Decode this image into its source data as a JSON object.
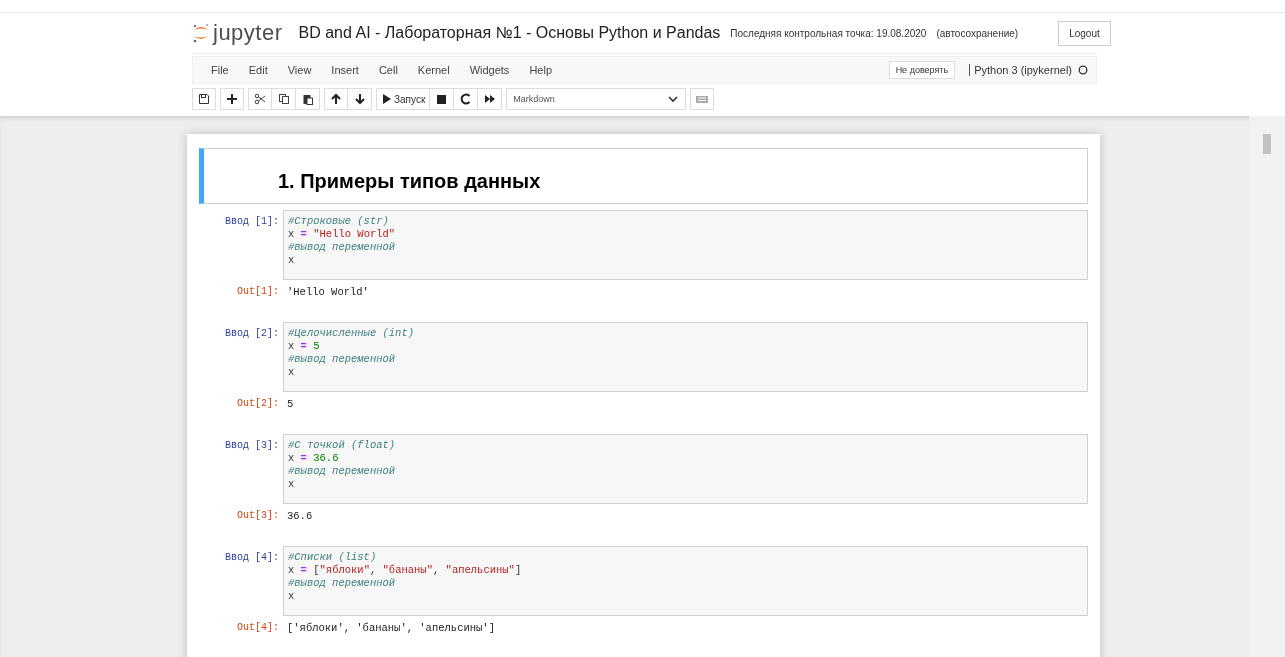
{
  "header": {
    "logo_text": "jupyter",
    "title": "BD and AI - Лабораторная №1 - Основы Python и Pandas",
    "checkpoint": "Последняя контрольная точка: 19.08.2020",
    "autosave": "(автосохранение)",
    "logout": "Logout"
  },
  "menu": {
    "items": [
      "File",
      "Edit",
      "View",
      "Insert",
      "Cell",
      "Kernel",
      "Widgets",
      "Help"
    ],
    "trust": "Не доверять",
    "kernel": {
      "name": "Python 3 (ipykernel)",
      "busy": false
    }
  },
  "toolbar": {
    "run_label": "Запуск",
    "cell_type": "Markdown"
  },
  "cells": [
    {
      "kind": "markdown",
      "selected": true,
      "heading": "1. Примеры типов данных"
    },
    {
      "kind": "code",
      "selected": false,
      "prompt": "Ввод [1]:",
      "lines": [
        [
          {
            "kind": "comment",
            "text": "#Строковые (str)"
          }
        ],
        [
          {
            "kind": "name",
            "text": "x "
          },
          {
            "kind": "operator",
            "text": "="
          },
          {
            "kind": "string",
            "text": " \"Hello World\""
          }
        ],
        [
          {
            "kind": "comment",
            "text": "#вывод переменной"
          }
        ],
        [
          {
            "kind": "name",
            "text": "x"
          }
        ]
      ],
      "out_prompt": "Out[1]:",
      "output": "'Hello World'"
    },
    {
      "kind": "code",
      "selected": false,
      "prompt": "Ввод [2]:",
      "lines": [
        [
          {
            "kind": "comment",
            "text": "#Целочисленные (int)"
          }
        ],
        [
          {
            "kind": "name",
            "text": "x "
          },
          {
            "kind": "operator",
            "text": "="
          },
          {
            "kind": "number",
            "text": " 5"
          }
        ],
        [
          {
            "kind": "comment",
            "text": "#вывод переменной"
          }
        ],
        [
          {
            "kind": "name",
            "text": "x"
          }
        ]
      ],
      "out_prompt": "Out[2]:",
      "output": "5"
    },
    {
      "kind": "code",
      "selected": false,
      "prompt": "Ввод [3]:",
      "lines": [
        [
          {
            "kind": "comment",
            "text": "#С точкой (float)"
          }
        ],
        [
          {
            "kind": "name",
            "text": "x "
          },
          {
            "kind": "operator",
            "text": "="
          },
          {
            "kind": "number",
            "text": " 36.6"
          }
        ],
        [
          {
            "kind": "comment",
            "text": "#вывод переменной"
          }
        ],
        [
          {
            "kind": "name",
            "text": "x"
          }
        ]
      ],
      "out_prompt": "Out[3]:",
      "output": "36.6"
    },
    {
      "kind": "code",
      "selected": false,
      "prompt": "Ввод [4]:",
      "lines": [
        [
          {
            "kind": "comment",
            "text": "#Списки (list)"
          }
        ],
        [
          {
            "kind": "name",
            "text": "x "
          },
          {
            "kind": "operator",
            "text": "="
          },
          {
            "kind": "name",
            "text": " ["
          },
          {
            "kind": "string",
            "text": "\"яблоки\""
          },
          {
            "kind": "name",
            "text": ", "
          },
          {
            "kind": "string",
            "text": "\"бананы\""
          },
          {
            "kind": "name",
            "text": ", "
          },
          {
            "kind": "string",
            "text": "\"апельсины\""
          },
          {
            "kind": "name",
            "text": "]"
          }
        ],
        [
          {
            "kind": "comment",
            "text": "#вывод переменной"
          }
        ],
        [
          {
            "kind": "name",
            "text": "x"
          }
        ]
      ],
      "out_prompt": "Out[4]:",
      "output": "['яблоки', 'бананы', 'апельсины']"
    }
  ]
}
